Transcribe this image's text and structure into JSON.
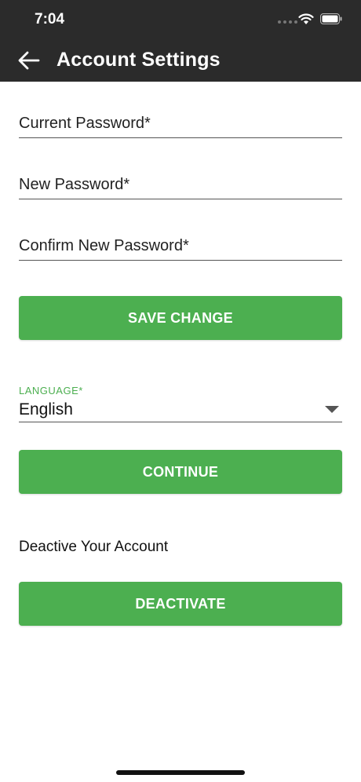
{
  "status_bar": {
    "time": "7:04"
  },
  "header": {
    "title": "Account Settings",
    "back_icon": "arrow-left-icon"
  },
  "form": {
    "current_password_label": "Current Password*",
    "new_password_label": "New Password*",
    "confirm_password_label": "Confirm New Password*",
    "save_button": "SAVE CHANGE"
  },
  "language": {
    "label": "LANGUAGE*",
    "selected": "English",
    "continue_button": "CONTINUE"
  },
  "deactivate": {
    "text": "Deactive Your Account",
    "button": "DEACTIVATE"
  },
  "colors": {
    "accent": "#4caf50",
    "header_bg": "#2b2b2b"
  }
}
